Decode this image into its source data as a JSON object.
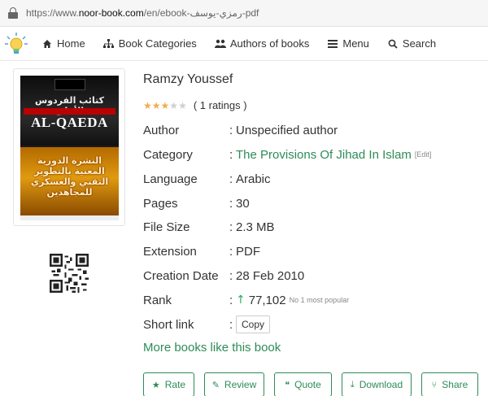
{
  "browser": {
    "url_prefix": "https://www.",
    "url_domain": "noor-book.com",
    "url_path": "/en/ebook-رمزي-يوسف-pdf"
  },
  "nav": {
    "items": [
      {
        "label": "Home",
        "icon": "home-icon"
      },
      {
        "label": "Book Categories",
        "icon": "sitemap-icon"
      },
      {
        "label": "Authors of books",
        "icon": "users-icon"
      },
      {
        "label": "Menu",
        "icon": "menu-icon"
      },
      {
        "label": "Search",
        "icon": "search-icon"
      }
    ]
  },
  "cover": {
    "arabic_top": "كتائب الفردوس الأعلى",
    "latin": "AL-QAEDA",
    "arabic_bottom": "النشرة الدورية المعنية بالتطوير التقني والعسكري للمجاهدين"
  },
  "book": {
    "title": "Ramzy Youssef",
    "rating_stars": 3,
    "rating_max": 5,
    "ratings_text": "( 1 ratings )",
    "fields": {
      "author": {
        "label": "Author",
        "value": "Unspecified author"
      },
      "category": {
        "label": "Category",
        "value": "The Provisions Of Jihad In Islam",
        "edit": "[Edit]"
      },
      "language": {
        "label": "Language",
        "value": "Arabic"
      },
      "pages": {
        "label": "Pages",
        "value": "30"
      },
      "file_size": {
        "label": "File Size",
        "value": "2.3 MB"
      },
      "extension": {
        "label": "Extension",
        "value": "PDF"
      },
      "creation_date": {
        "label": "Creation Date",
        "value": "28 Feb 2010"
      },
      "rank": {
        "label": "Rank",
        "value": "77,102",
        "note": "No 1 most popular"
      },
      "short_link": {
        "label": "Short link",
        "button": "Copy"
      }
    },
    "more_books": "More books like this book"
  },
  "actions": [
    {
      "label": "Rate",
      "icon": "star-icon"
    },
    {
      "label": "Review",
      "icon": "edit-icon"
    },
    {
      "label": "Quote",
      "icon": "quote-icon"
    },
    {
      "label": "Download",
      "icon": "download-icon"
    },
    {
      "label": "Share",
      "icon": "share-icon"
    }
  ],
  "colors": {
    "accent_green": "#2e8b57",
    "language_red": "#c0392b",
    "star_gold": "#f0ad4e"
  }
}
